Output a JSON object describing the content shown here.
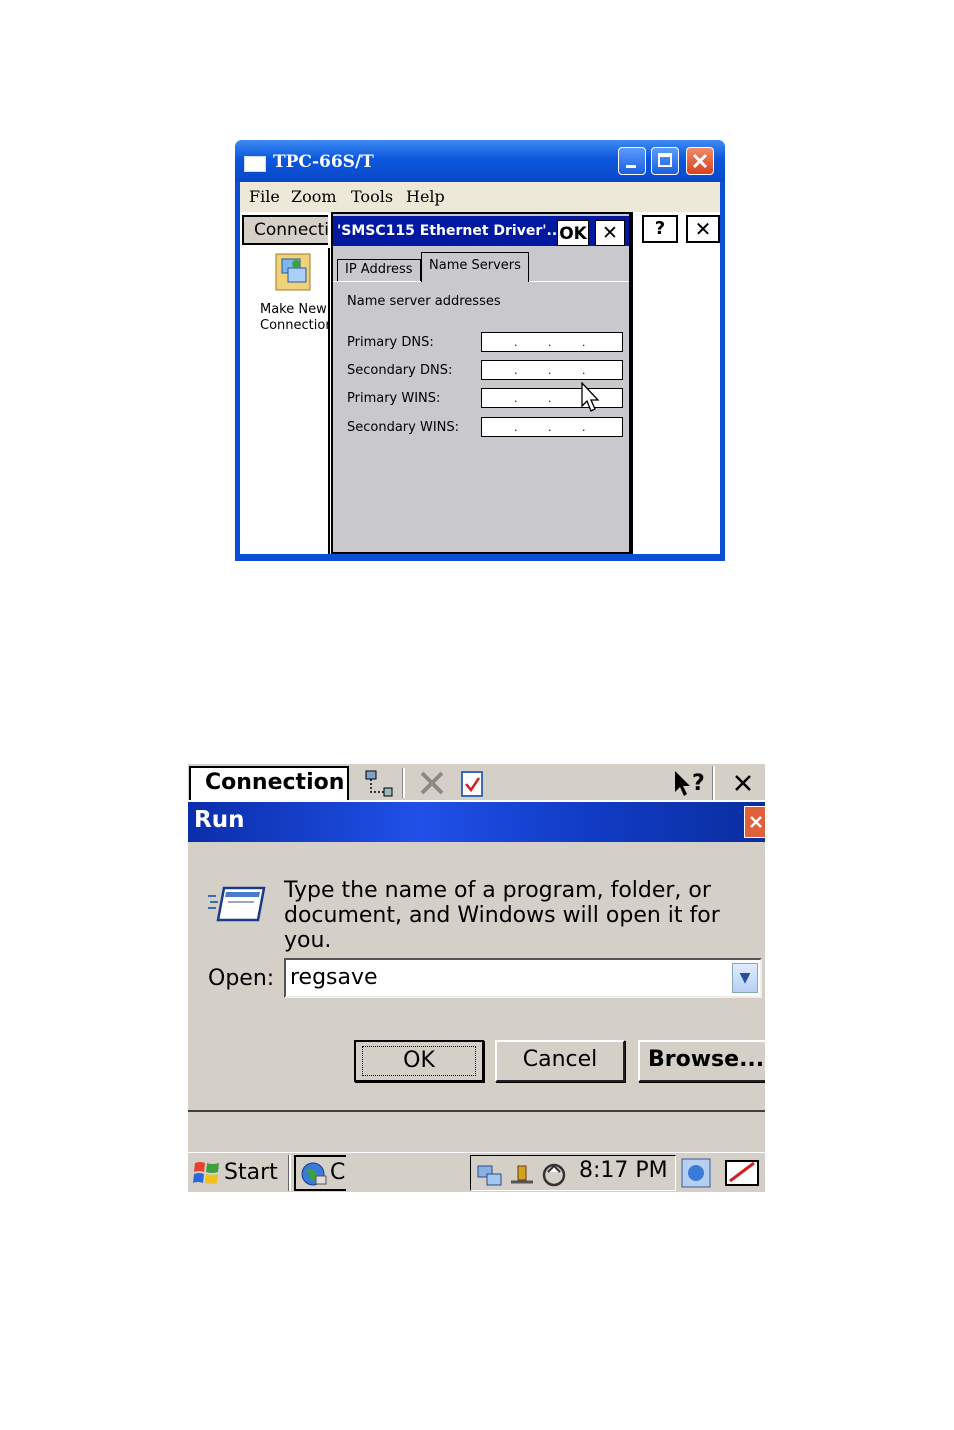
{
  "window1": {
    "title": "TPC-66S/T",
    "menu": [
      "File",
      "Zoom",
      "Tools",
      "Help"
    ],
    "connections_tab": "Connections",
    "help_label": "?",
    "close_label": "✕",
    "make_new_connection": "Make New Connection",
    "dialog": {
      "title": "'SMSC115 Ethernet Driver'...",
      "ok_label": "OK",
      "close_label": "✕",
      "tabs": [
        "IP Address",
        "Name Servers"
      ],
      "active_tab": "Name Servers",
      "heading": "Name server addresses",
      "fields": [
        {
          "label": "Primary DNS:"
        },
        {
          "label": "Secondary DNS:"
        },
        {
          "label": "Primary WINS:"
        },
        {
          "label": "Secondary WINS:"
        }
      ]
    }
  },
  "window2": {
    "connections_tab": "Connection",
    "help_label": "?",
    "close_label": "✕",
    "run_title": "Run",
    "description": "Type the name of a program, folder, or document, and Windows will open it for you.",
    "open_label": "Open:",
    "open_value": "regsave",
    "ok_label": "OK",
    "cancel_label": "Cancel",
    "browse_label": "Browse...",
    "taskbar": {
      "start_label": "Start",
      "task_label": "C",
      "clock": "8:17 PM"
    }
  }
}
